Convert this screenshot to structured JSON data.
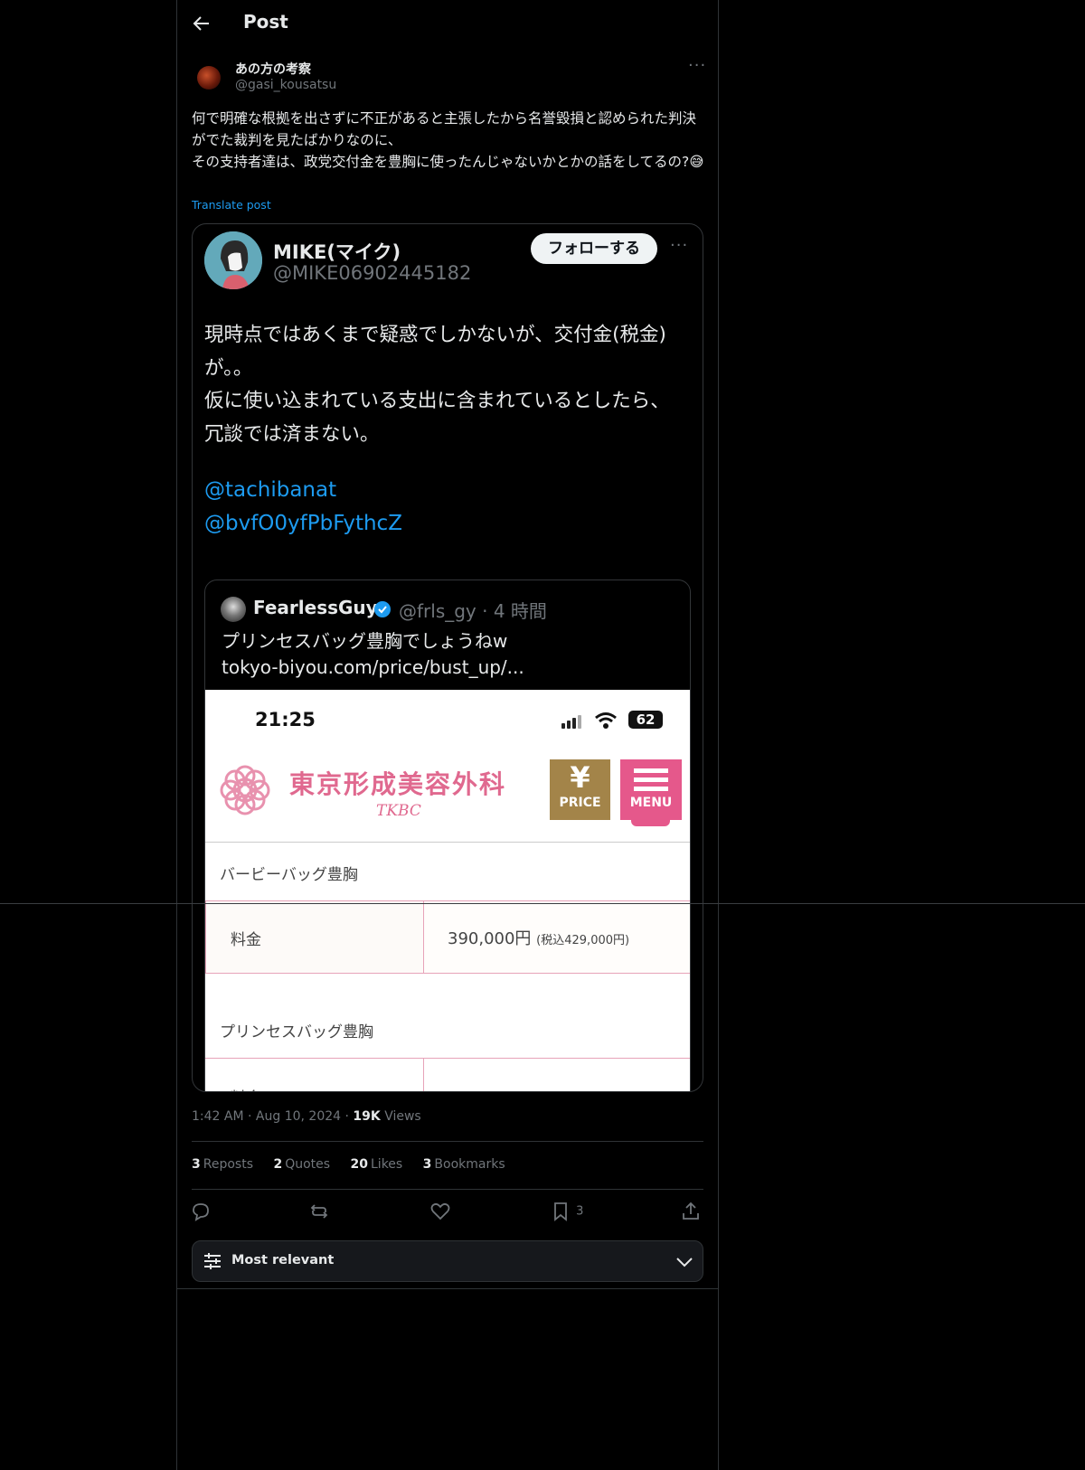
{
  "header": {
    "title": "Post"
  },
  "post": {
    "author_name": "あの方の考察",
    "author_handle": "@gasi_kousatsu",
    "text": "何で明確な根拠を出さずに不正があると主張したから名誉毀損と認められた判決がでた裁判を見たばかりなのに、\nその支持者達は、政党交付金を豊胸に使ったんじゃないかとかの話をしてるの?😅",
    "translate_label": "Translate post",
    "time": "1:42 AM",
    "date": "Aug 10, 2024",
    "views_count": "19K",
    "views_label": "Views"
  },
  "embedded": {
    "name": "MIKE(マイク)",
    "handle": "@MIKE06902445182",
    "follow_label": "フォローする",
    "text": "現時点ではあくまで疑惑でしかないが、交付金(税金)が。。\n仮に使い込まれている支出に含まれているとしたら、冗談では済まない。",
    "mention1": "@tachibanat",
    "mention2": "@bvfO0yfPbFythcZ",
    "quote": {
      "name": "FearlessGuy",
      "handle": "@frls_gy · 4 時間",
      "text": "プリンセスバッグ豊胸でしょうねw\ntokyo-biyou.com/price/bust_up/...",
      "screenshot": {
        "status_time": "21:25",
        "battery": "62",
        "clinic_name": "東京形成美容外科",
        "clinic_sub": "TKBC",
        "price_symbol": "¥",
        "price_label": "PRICE",
        "menu_label": "MENU",
        "section1_title": "バービーバッグ豊胸",
        "row1_label": "料金",
        "row1_value": "390,000円",
        "row1_tax": "(税込429,000円)",
        "section2_title": "プリンセスバッグ豊胸",
        "row2_label": "料金"
      }
    }
  },
  "stats": {
    "reposts_count": "3",
    "reposts_label": "Reposts",
    "quotes_count": "2",
    "quotes_label": "Quotes",
    "likes_count": "20",
    "likes_label": "Likes",
    "bookmarks_count": "3",
    "bookmarks_label": "Bookmarks"
  },
  "actions": {
    "bookmark_count": "3"
  },
  "sort": {
    "label": "Most relevant"
  },
  "colors": {
    "accent": "#1d9bf0",
    "background": "#000000",
    "muted": "#71767b",
    "clinic_pink": "#e0698f",
    "price_gold": "#a38449"
  }
}
